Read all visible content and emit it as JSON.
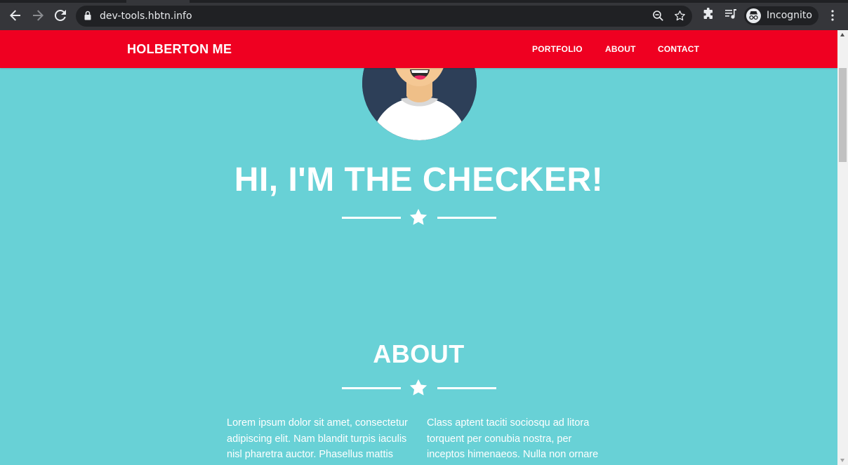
{
  "browser": {
    "url": "dev-tools.hbtn.info",
    "profile_label": "Incognito"
  },
  "navbar": {
    "brand": "HOLBERTON ME",
    "links": [
      "PORTFOLIO",
      "ABOUT",
      "CONTACT"
    ]
  },
  "hero": {
    "title": "HI, I'M THE CHECKER!"
  },
  "about": {
    "title": "ABOUT",
    "col1": [
      "Lorem ipsum dolor sit amet, consectetur",
      "adipiscing elit. Nam blandit turpis iaculis",
      "nisl pharetra auctor. Phasellus mattis"
    ],
    "col2": [
      "Class aptent taciti sociosqu ad litora",
      "torquent per conubia nostra, per",
      "inceptos himenaeos. Nulla non ornare"
    ]
  },
  "colors": {
    "navbar": "#ef0021",
    "background": "#68d1d6",
    "text": "#ffffff"
  },
  "icons": [
    "back-arrow-icon",
    "forward-arrow-icon",
    "reload-icon",
    "lock-icon",
    "zoom-icon",
    "bookmark-star-icon",
    "extensions-icon",
    "media-icon",
    "incognito-icon",
    "menu-kebab-icon",
    "star-icon"
  ]
}
